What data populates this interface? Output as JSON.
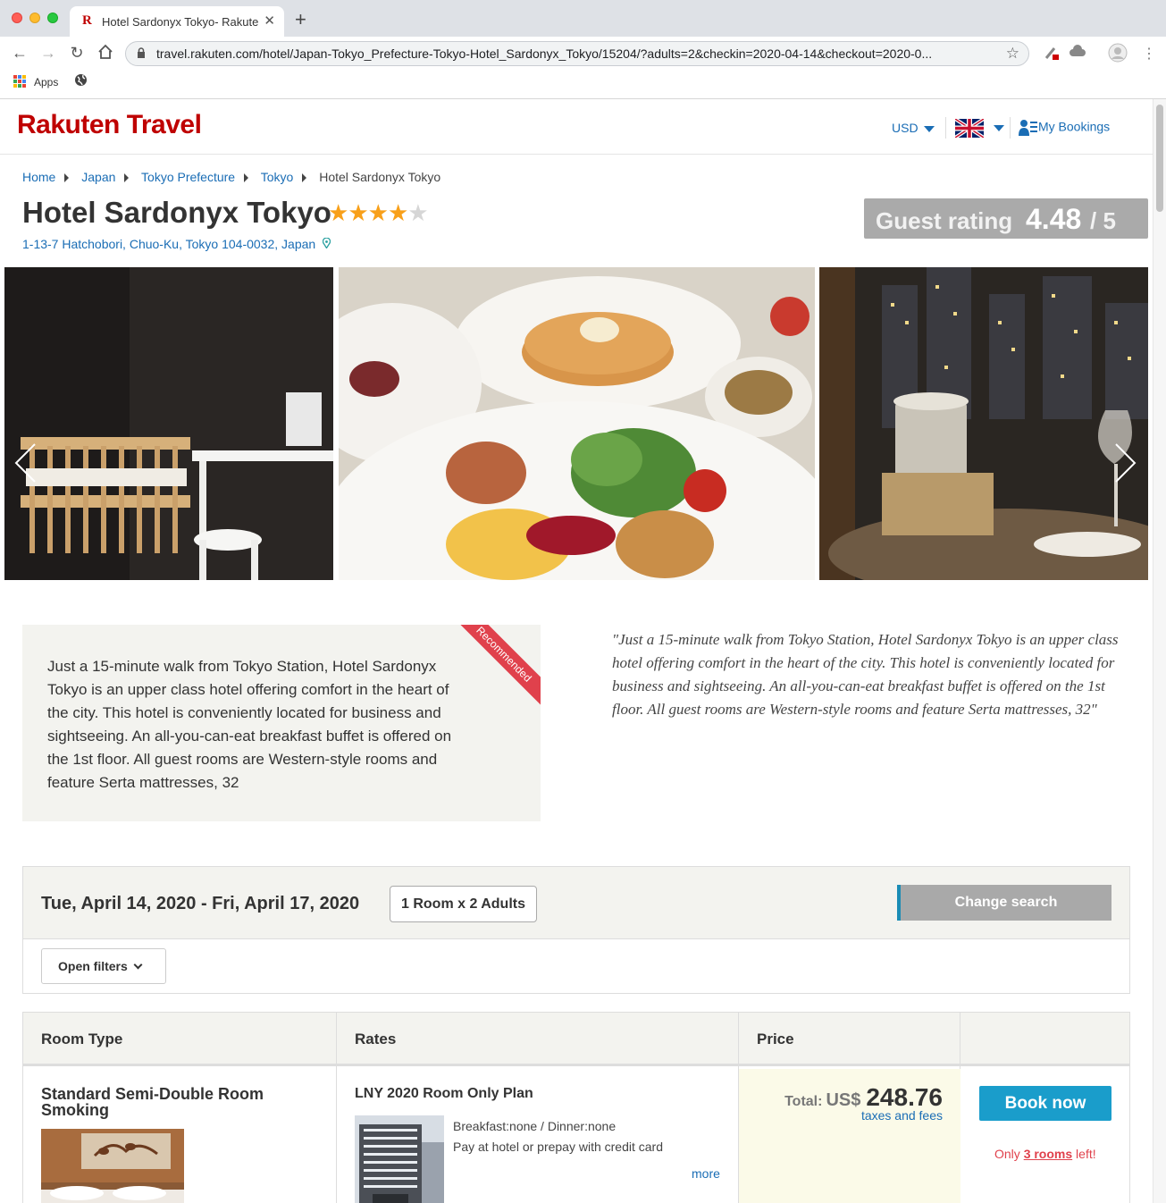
{
  "browser": {
    "tab_title": "Hotel Sardonyx Tokyo- Rakuten",
    "tab_favicon": "R",
    "url": "travel.rakuten.com/hotel/Japan-Tokyo_Prefecture-Tokyo-Hotel_Sardonyx_Tokyo/15204/?adults=2&checkin=2020-04-14&checkout=2020-0...",
    "bookmarks": {
      "apps_label": "Apps"
    }
  },
  "header": {
    "logo": "Rakuten Travel",
    "currency": "USD",
    "my_bookings": "My Bookings"
  },
  "breadcrumb": {
    "items": [
      "Home",
      "Japan",
      "Tokyo Prefecture",
      "Tokyo"
    ],
    "current": "Hotel Sardonyx Tokyo"
  },
  "hotel": {
    "name": "Hotel Sardonyx Tokyo",
    "star_rating": 4,
    "star_max": 5,
    "address": "1-13-7 Hatchobori, Chuo-Ku, Tokyo 104-0032, Japan"
  },
  "guest_rating": {
    "label": "Guest rating",
    "value": "4.48",
    "max": "/ 5"
  },
  "description": {
    "ribbon": "Recommended",
    "text": "Just a 15-minute walk from Tokyo Station, Hotel Sardonyx Tokyo is an upper class hotel offering comfort in the heart of the city. This hotel is conveniently located for business and sightseeing. An all-you-can-eat breakfast buffet is offered on the 1st floor. All guest rooms are Western-style rooms and feature Serta mattresses, 32",
    "quote": "\"Just a 15-minute walk from Tokyo Station, Hotel Sardonyx Tokyo is an upper class hotel offering comfort in the heart of the city. This hotel is conveniently located for business and sightseeing. An all-you-can-eat breakfast buffet is offered on the 1st floor. All guest rooms are Western-style rooms and feature Serta mattresses, 32\""
  },
  "search": {
    "dates": "Tue, April 14, 2020 - Fri, April 17, 2020",
    "occupancy": "1 Room x 2 Adults",
    "change_search": "Change search",
    "open_filters": "Open filters"
  },
  "table": {
    "headers": [
      "Room Type",
      "Rates",
      "Price"
    ],
    "rows": [
      {
        "room_name": "Standard Semi-Double Room Smoking",
        "plan_name": "LNY 2020 Room Only Plan",
        "meals": "Breakfast:none / Dinner:none",
        "payment": "Pay at hotel or prepay with credit card",
        "more": "more",
        "total_label": "Total:",
        "currency": "US$",
        "price": "248.76",
        "taxes": "taxes and fees",
        "book_label": "Book now",
        "rooms_left_prefix": "Only ",
        "rooms_left_count": "3 rooms",
        "rooms_left_suffix": " left!"
      }
    ]
  },
  "colors": {
    "brand": "#bf0000",
    "link": "#1a6db5",
    "book_button": "#1a9dcb",
    "ribbon": "#e0414c",
    "star": "#f8a01a"
  },
  "icons": [
    "back-icon",
    "forward-icon",
    "reload-icon",
    "home-icon",
    "lock-icon",
    "bookmark-star-icon",
    "globe-icon",
    "map-pin-icon",
    "user-icon",
    "uk-flag-icon",
    "chevron-left-icon",
    "chevron-right-icon",
    "chevron-down-icon"
  ]
}
